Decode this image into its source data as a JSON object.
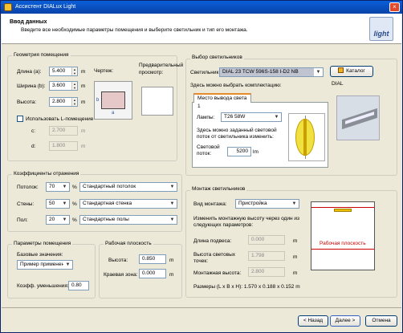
{
  "window": {
    "title": "Ассистент DIALux Light"
  },
  "header": {
    "title": "Ввод данных",
    "subtitle": "Введите все необходимые параметры помещения и выберите светильник и тип его монтажа.",
    "logo": "light"
  },
  "geometry": {
    "title": "Геометрия помещения",
    "length_label": "Длина (a):",
    "length": "5.400",
    "width_label": "Ширина (b):",
    "width": "3.600",
    "height_label": "Высота:",
    "height": "2.800",
    "unit": "m",
    "lshape_label": "Использовать L-помещение",
    "c_label": "c:",
    "c": "2.700",
    "d_label": "d:",
    "d": "1.800",
    "drawing_label": "Чертеж:",
    "preview_label": "Предварительный просмотр:",
    "dim_a": "a",
    "dim_b": "b"
  },
  "reflect": {
    "title": "Коэффициенты отражения",
    "rows": [
      {
        "label": "Потолок:",
        "value": "70",
        "pct": "%",
        "preset": "Стандартный потолок"
      },
      {
        "label": "Стены:",
        "value": "50",
        "pct": "%",
        "preset": "Стандартная стенка"
      },
      {
        "label": "Пол:",
        "value": "20",
        "pct": "%",
        "preset": "Стандартные полы"
      }
    ]
  },
  "room_params": {
    "title": "Параметры помещения",
    "base_label": "Базовые значения:",
    "base": "Пример применения",
    "reduce_label": "Коэфф. уменьшения:",
    "reduce": "0.80"
  },
  "work_plane": {
    "title": "Рабочая плоскость",
    "height_label": "Высота:",
    "height": "0.850",
    "edge_label": "Краевая зона:",
    "edge": "0.000",
    "unit": "m"
  },
  "luminaire": {
    "title": "Выбор светильников",
    "label": "Светильник:",
    "value": "DIAL 23 TCW 596S-158 I-D2 NB",
    "catalog_button": "Каталог",
    "brand": "DIAL",
    "config_label": "Здесь можно выбрать комплектацию:",
    "tab": "Место вывода света 1",
    "lamps_label": "Лампы:",
    "lamp": "T26 58W",
    "flux_note": "Здесь можно заданный световой поток от светильника изменить:",
    "flux_label": "Световой поток:",
    "flux": "5200",
    "flux_unit": "lm"
  },
  "mounting": {
    "title": "Монтаж светильников",
    "type_label": "Вид монтажа:",
    "type": "Пристройка",
    "note": "Изменить монтажную высоту через один из следующих параметров:",
    "rows": [
      {
        "label": "Длина подвеса:",
        "value": "0.000",
        "unit": "m"
      },
      {
        "label": "Высота световых точек:",
        "value": "1.798",
        "unit": "m"
      },
      {
        "label": "Монтажная высота:",
        "value": "2.800",
        "unit": "m"
      }
    ],
    "sizes": "Размеры (L x B x H): 1.570 x 0.188 x 0.152 m",
    "diagram_label": "Рабочая плоскость"
  },
  "footer": {
    "back": "< Назад",
    "next": "Далее >",
    "cancel": "Отмена"
  }
}
